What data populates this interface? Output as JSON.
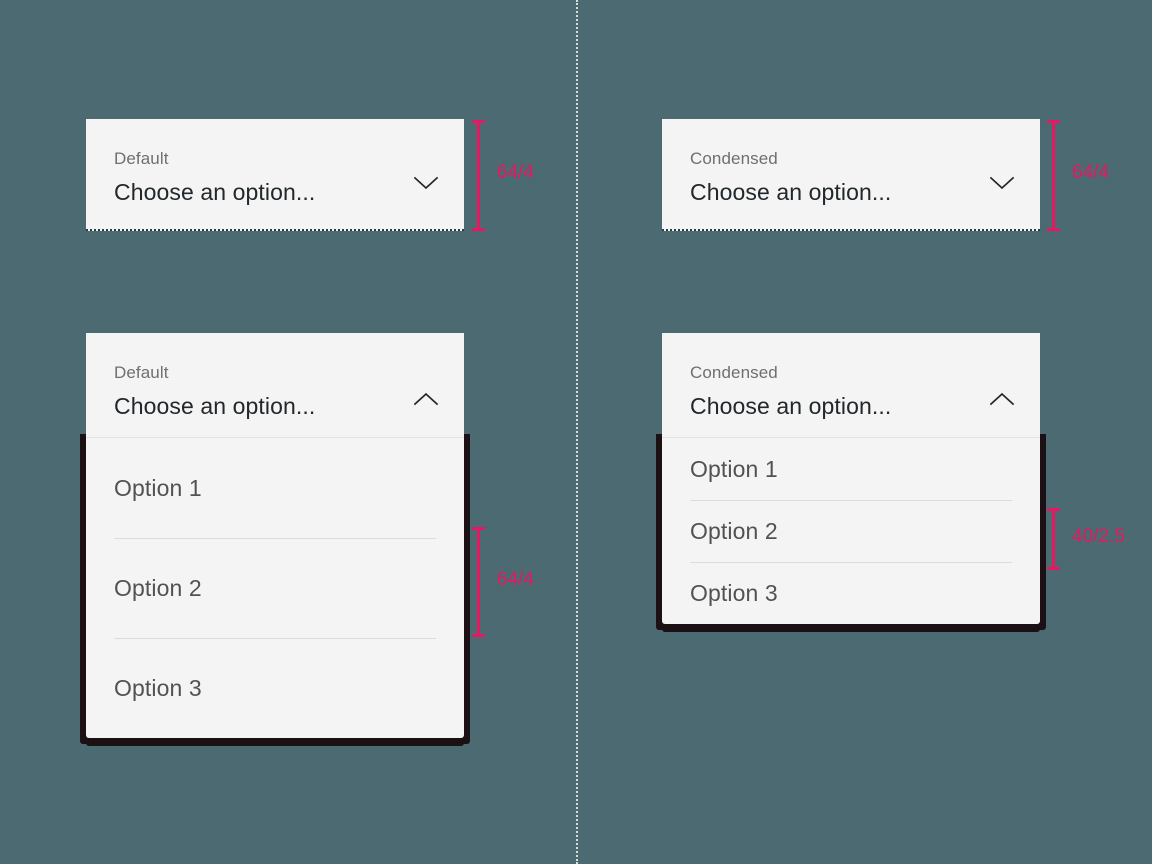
{
  "page": {
    "background_color": "#4c6a72",
    "accent_color": "#e5195f",
    "field_background": "#f4f4f4",
    "divider_color": "#d6dcdd"
  },
  "columns": {
    "left": {
      "variant": "Default",
      "closed_select": {
        "label": "Default",
        "value": "Choose an option...",
        "chevron": "chevron-down-icon",
        "measurement": "64/4"
      },
      "open_select": {
        "label": "Default",
        "value": "Choose an option...",
        "chevron": "chevron-up-icon",
        "options": [
          {
            "label": "Option 1"
          },
          {
            "label": "Option 2"
          },
          {
            "label": "Option 3"
          }
        ],
        "measurement": "64/4"
      }
    },
    "right": {
      "variant": "Condensed",
      "closed_select": {
        "label": "Condensed",
        "value": "Choose an option...",
        "chevron": "chevron-down-icon",
        "measurement": "64/4"
      },
      "open_select": {
        "label": "Condensed",
        "value": "Choose an option...",
        "chevron": "chevron-up-icon",
        "options": [
          {
            "label": "Option 1"
          },
          {
            "label": "Option 2"
          },
          {
            "label": "Option 3"
          }
        ],
        "measurement": "40/2.5"
      }
    }
  }
}
